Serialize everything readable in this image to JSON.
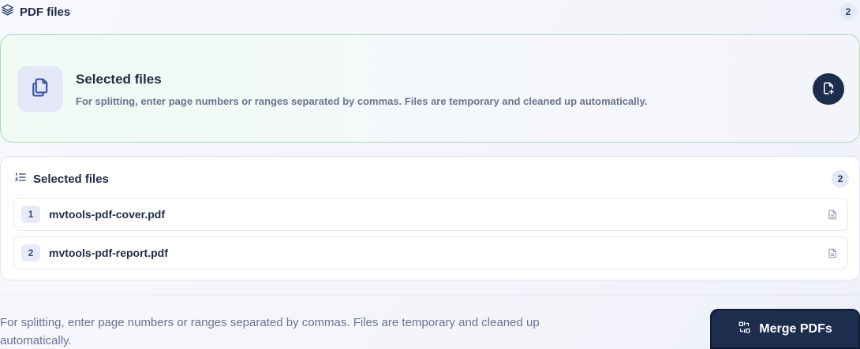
{
  "header": {
    "title": "PDF files",
    "count": "2",
    "icon": "layers-icon"
  },
  "dropzone": {
    "title": "Selected files",
    "description": "For splitting, enter page numbers or ranges separated by commas. Files are temporary and cleaned up automatically.",
    "icon": "copy-files-icon",
    "add_icon": "file-plus-icon"
  },
  "files_panel": {
    "title": "Selected files",
    "count": "2",
    "icon": "numbered-list-icon",
    "files": [
      {
        "index": "1",
        "name": "mvtools-pdf-cover.pdf"
      },
      {
        "index": "2",
        "name": "mvtools-pdf-report.pdf"
      }
    ]
  },
  "footer": {
    "note": "For splitting, enter page numbers or ranges separated by commas. Files are temporary and cleaned up automatically.",
    "merge_label": "Merge PDFs",
    "merge_icon": "merge-icon"
  },
  "colors": {
    "primary": "#1d2d4e",
    "badge_bg": "#e3e8f8",
    "dropzone_border": "#a9dbbd",
    "muted_text": "#6a7390"
  }
}
